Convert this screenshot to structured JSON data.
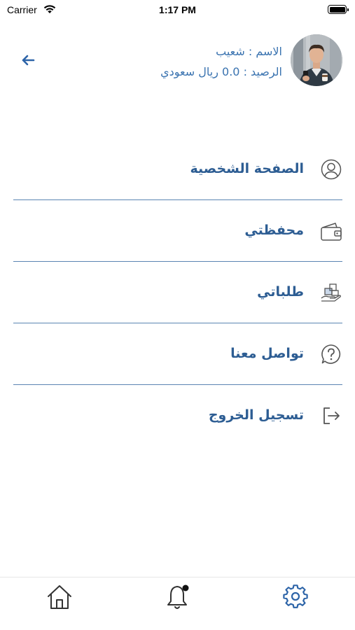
{
  "status_bar": {
    "carrier": "Carrier",
    "time": "1:17 PM"
  },
  "header": {
    "name_label": "الاسم :",
    "name_value": "شعيب",
    "balance_label": "الرصيد :",
    "balance_value": "0.0 ريال سعودي",
    "accent_color": "#3a73b0"
  },
  "menu": {
    "items": [
      {
        "label": "الصفحة الشخصية",
        "icon": "user-circle-icon"
      },
      {
        "label": "محفظتي",
        "icon": "wallet-icon"
      },
      {
        "label": "طلباتي",
        "icon": "orders-icon"
      },
      {
        "label": "تواصل معنا",
        "icon": "question-circle-icon"
      },
      {
        "label": "تسجيل الخروج",
        "icon": "logout-icon"
      }
    ],
    "label_color": "#2d5d93",
    "divider_color": "#5a84b2"
  },
  "tab_bar": {
    "tabs": [
      {
        "icon": "home-icon"
      },
      {
        "icon": "bell-icon",
        "has_badge": true
      },
      {
        "icon": "gear-icon",
        "active": true
      }
    ],
    "active_color": "#2d64a8"
  }
}
